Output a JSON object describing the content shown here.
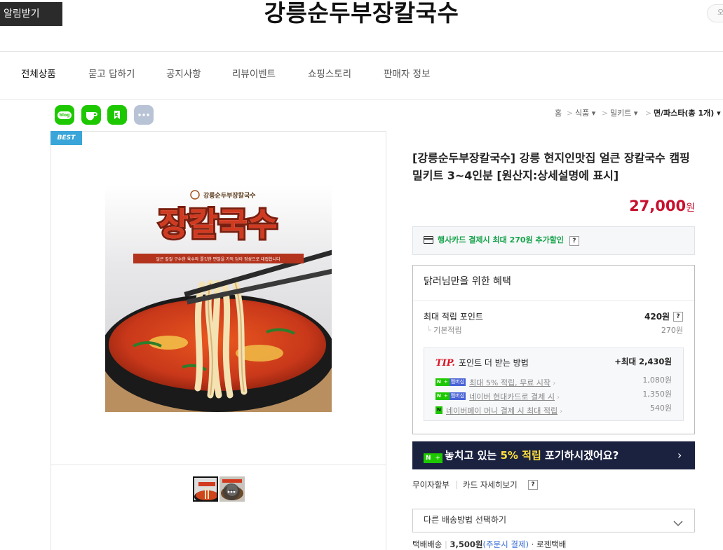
{
  "header": {
    "notify_label": "알림받기",
    "store_name": "강릉순두부장칼국수",
    "search_placeholder": "오"
  },
  "nav": [
    "전체상품",
    "묻고 답하기",
    "공지사항",
    "리뷰이벤트",
    "쇼핑스토리",
    "판매자 정보"
  ],
  "share": {
    "blog_label": "blog"
  },
  "breadcrumb": [
    "홈",
    "식품",
    "밀키트",
    "면/파스타(총 1개)"
  ],
  "product": {
    "badge": "BEST",
    "image_brand": "강릉순두부장칼국수",
    "image_headline": "장칼국수",
    "image_subline": "얼큰 칼칼 구수한 육수와 쫄깃한 면발을 가득 담아 정성으로 대접합니다",
    "title": "[강릉순두부장칼국수] 강릉 현지인맛집 얼큰 장칼국수 캠핑 밀키트 3~4인분 [원산지:상세설명에 표시]",
    "price": "27,000",
    "currency": "원"
  },
  "card_discount": {
    "text": "행사카드 결제시 최대 270원 추가할인",
    "help": "?"
  },
  "benefits": {
    "title": "닭러님만을 위한 혜택",
    "max_points_label": "최대 적립 포인트",
    "max_points_value": "420원",
    "base_label": "기본적립",
    "base_value": "270원",
    "tip_label": "TIP.",
    "tip_text": "포인트 더 받는 방법",
    "tip_max": "+최대 2,430원",
    "badge_n": "N",
    "badge_plus": "+",
    "badge_member": "멤버십",
    "tips": [
      {
        "text": "최대 5% 적립, 무료 시작",
        "value": "1,080원"
      },
      {
        "text": "네이버 현대카드로 결제 시",
        "value": "1,350원"
      },
      {
        "text": "네이버페이 머니 결제 시 최대 적립",
        "value": "540원"
      }
    ]
  },
  "banner": {
    "text_before": "놓치고 있는 ",
    "highlight": "5% 적립",
    "text_after": " 포기하시겠어요?"
  },
  "links": {
    "installment": "무이자할부",
    "card_detail": "카드 자세히보기",
    "help": "?"
  },
  "shipping": {
    "select_label": "다른 배송방법 선택하기",
    "method": "택배배송",
    "fee": "3,500원",
    "fee_note": "(주문시 결제)",
    "carrier": "· 로젠택배"
  },
  "colors": {
    "price": "#c8102e",
    "naver_green": "#1ec800",
    "banner_bg": "#1b2240",
    "banner_highlight": "#ffe03c"
  }
}
